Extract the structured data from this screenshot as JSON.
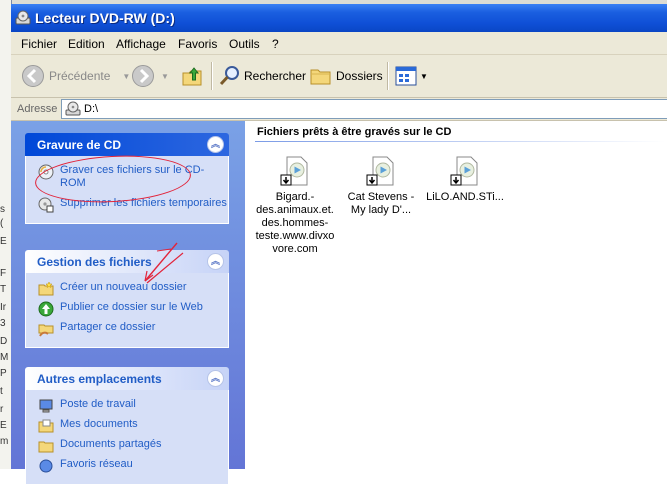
{
  "window": {
    "title": "Lecteur DVD-RW (D:)"
  },
  "menu": [
    "Fichier",
    "Edition",
    "Affichage",
    "Favoris",
    "Outils",
    "?"
  ],
  "toolbar": {
    "back": "Précédente",
    "search": "Rechercher",
    "folders": "Dossiers"
  },
  "address": {
    "label": "Adresse",
    "value": "D:\\"
  },
  "panels": [
    {
      "title": "Gravure de CD",
      "tasks": [
        "Graver ces fichiers sur le CD-ROM",
        "Supprimer les fichiers temporaires"
      ]
    },
    {
      "title": "Gestion des fichiers",
      "tasks": [
        "Créer un nouveau dossier",
        "Publier ce dossier sur le Web",
        "Partager ce dossier"
      ]
    },
    {
      "title": "Autres emplacements",
      "tasks": [
        "Poste de travail",
        "Mes documents",
        "Documents partagés",
        "Favoris réseau"
      ]
    }
  ],
  "content": {
    "group_header": "Fichiers prêts à être gravés sur le CD",
    "files": [
      {
        "name": "Bigard.-des.animaux.et.des.hommes-teste.www.divxovore.com"
      },
      {
        "name": "Cat Stevens - My lady D'..."
      },
      {
        "name": "LiLO.AND.STi..."
      }
    ]
  },
  "background_window": {
    "fragments": [
      "s",
      "(",
      "E",
      "F",
      "T",
      "Ir",
      "3",
      "D",
      "M",
      "P",
      "t",
      "r",
      "E",
      "m"
    ]
  },
  "colors": {
    "titlebar": "#0f4fd6",
    "link": "#215dc6",
    "annotation": "#e2243a"
  }
}
